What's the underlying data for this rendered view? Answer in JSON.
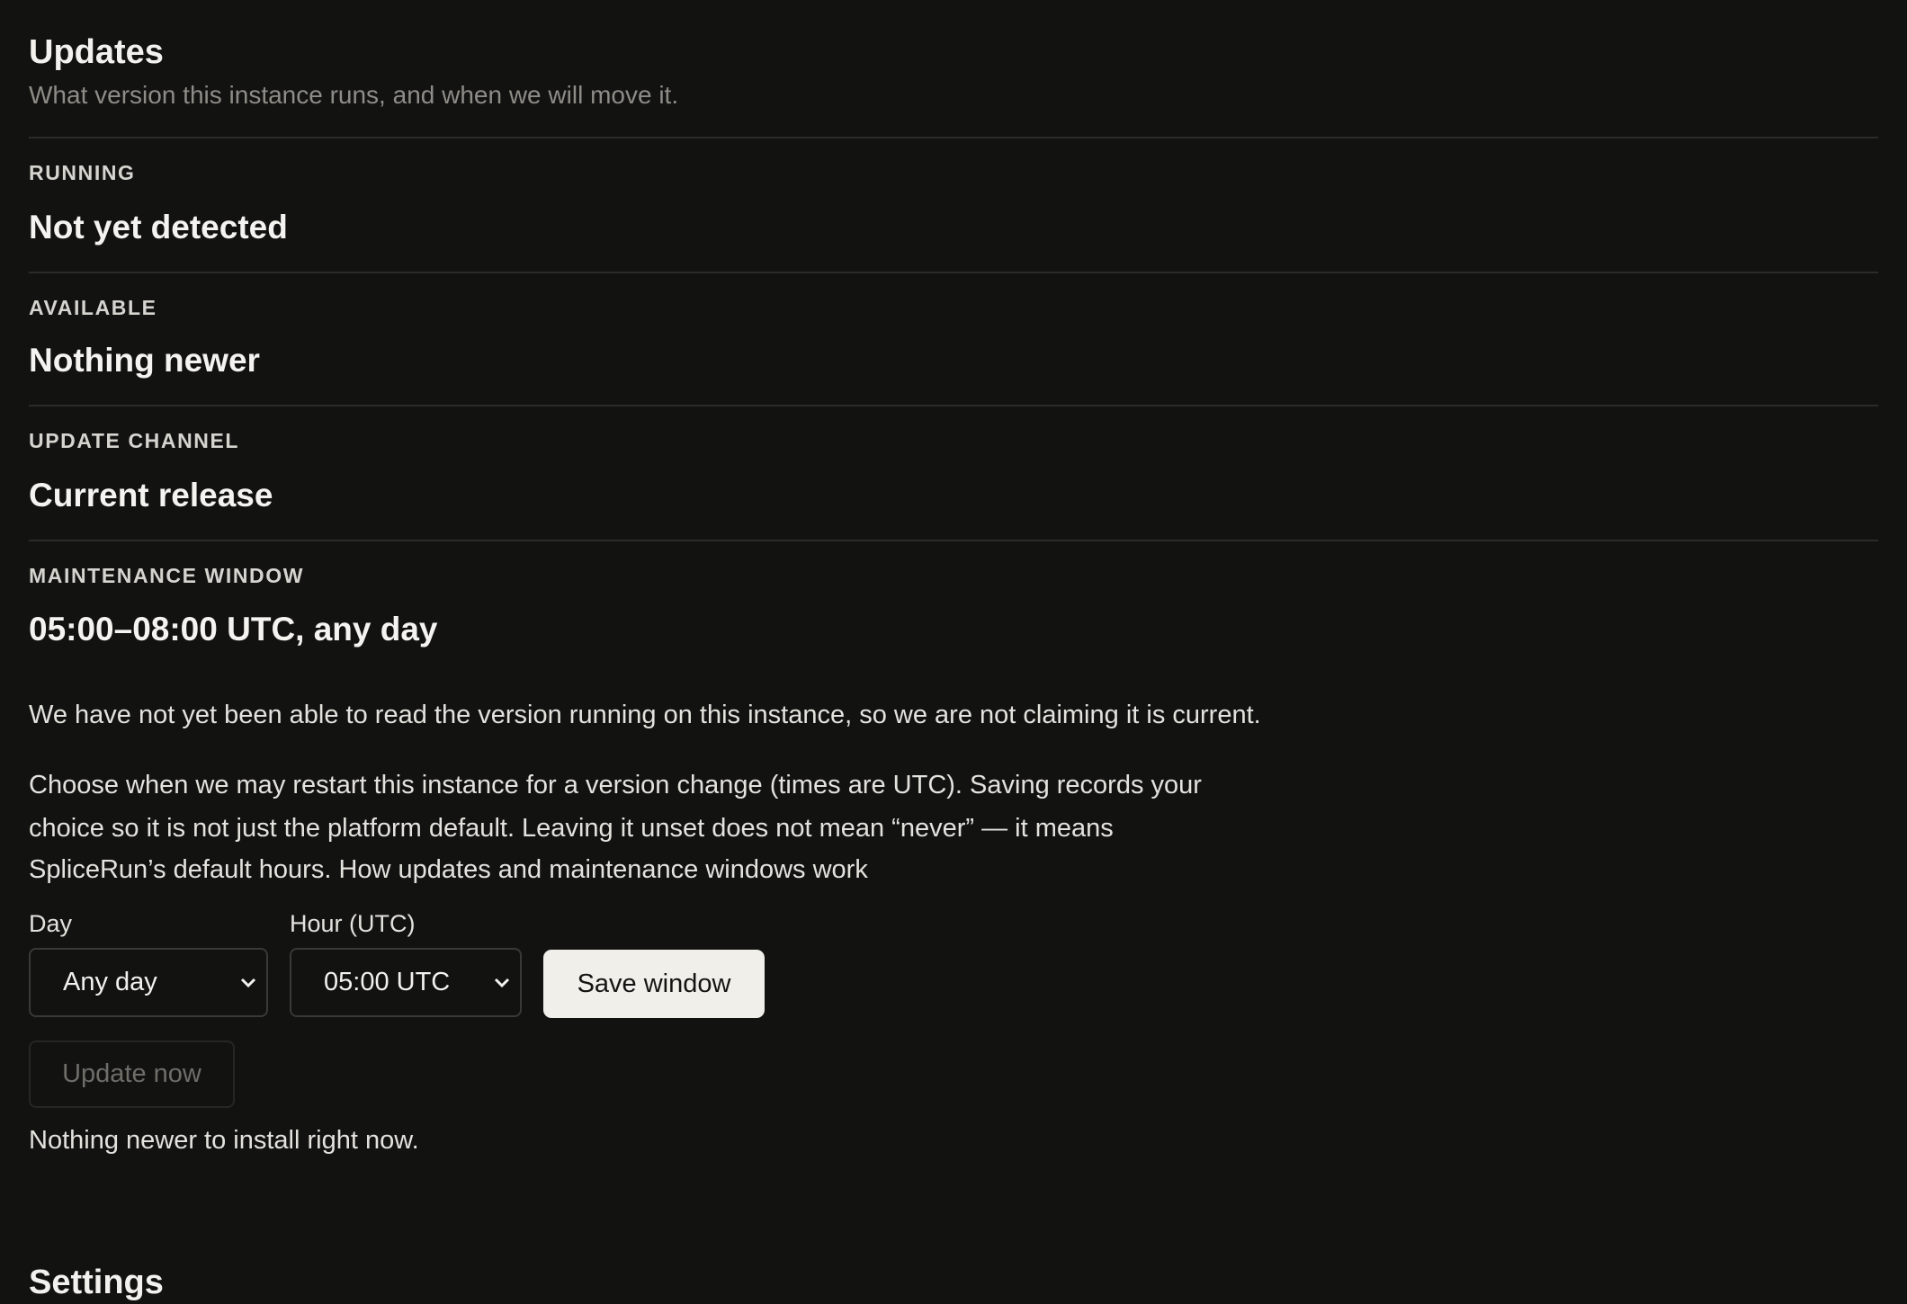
{
  "updates": {
    "title": "Updates",
    "subtitle": "What version this instance runs, and when we will move it.",
    "rows": [
      {
        "label": "RUNNING",
        "value": "Not yet detected"
      },
      {
        "label": "AVAILABLE",
        "value": "Nothing newer"
      },
      {
        "label": "UPDATE CHANNEL",
        "value": "Current release"
      },
      {
        "label": "MAINTENANCE WINDOW",
        "value": "05:00–08:00 UTC, any day"
      }
    ],
    "version_note": "We have not yet been able to read the version running on this instance, so we are not claiming it is current.",
    "window_help": {
      "line1": "Choose when we may restart this instance for a version change (times are UTC). Saving records your",
      "line2": "choice so it is not just the platform default. Leaving it unset does not mean “never” — it means",
      "line3": "SpliceRun’s default hours. How updates and maintenance windows work"
    },
    "form": {
      "day_label": "Day",
      "day_value": "Any day",
      "hour_label": "Hour (UTC)",
      "hour_value": "05:00 UTC",
      "save_label": "Save window"
    },
    "update_now_label": "Update now",
    "status_note": "Nothing newer to install right now."
  },
  "next_section": {
    "title": "Settings"
  },
  "icons": {
    "select_arrow": "chevron-down-icon"
  },
  "colors": {
    "background": "#121211",
    "text": "#ecebe7",
    "muted": "#8e8c86",
    "button": "#f0efea"
  }
}
